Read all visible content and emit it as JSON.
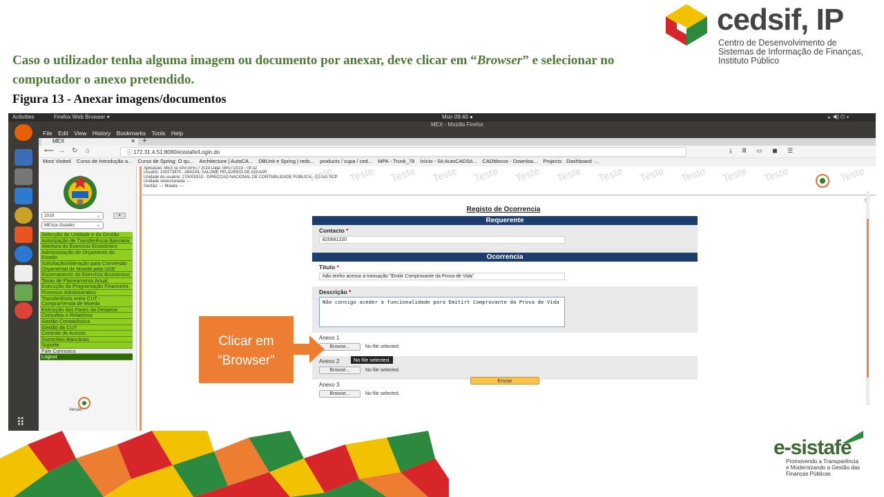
{
  "slide": {
    "intro_before": "Caso o utilizador tenha alguma imagem ou documento por anexar, deve clicar em “",
    "intro_emph": "Browser",
    "intro_after": "” e selecionar no computador o anexo pretendido.",
    "figure_caption": "Figura 13 - Anexar imagens/documentos"
  },
  "cedsif": {
    "name": "cedsif, IP",
    "subtitle_1": "Centro de Desenvolvimento de",
    "subtitle_2": "Sistemas de Informação de Finanças,",
    "subtitle_3": "Instituto Público"
  },
  "desktop": {
    "activities": "Activities",
    "app_menu": "Firefox Web Browser ▾",
    "clock": "Mon 09:40 ●",
    "window_title": "MEX - Mozilla Firefox"
  },
  "browser": {
    "menu": [
      "File",
      "Edit",
      "View",
      "History",
      "Bookmarks",
      "Tools",
      "Help"
    ],
    "tab_label": "MEX",
    "url": "172.31.4.51:8080/esistafe/Login.do",
    "bookmarks": [
      "Most Visited",
      "Curso de Introdução a...",
      "Curso de Spring: O qu...",
      "Architecture | AutoCA...",
      "DBUnit e Spring | reds...",
      "products / cupa / ced...",
      "MPA - Trunk_78",
      "Início - Só AutoCADSó...",
      "CADblocos - Downloa...",
      "Projects · Dashboard ·..."
    ]
  },
  "app": {
    "year": "2019",
    "module": "MEX(e-Sistafe)",
    "go_label": "»",
    "info_line_1": "Aplicação: MEX (e-SISTAFE) / 2019   Data: 08/07/2019 - 09:32",
    "info_line_2": "Usuário: 100273470 - ABIGAIL SALOMÉ FELIZARDO DE AGUIAR",
    "info_line_3": "Unidade do usuário: 27A000313 - DIRECCAO NACIONAL DE CONTABILIDADE PUBLICA - UG DO SCP",
    "info_line_4": "Unidade seleccionada: ---",
    "info_line_5": "Gestão: ---        Moeda: ---",
    "watermark": "Teste",
    "version_label": "Versão",
    "menu_items": [
      "Selecção de Unidade e da Gestão",
      "Autorização de Transferência Bancária",
      "Abertura do Exercício Económico",
      "Administração do Orçamento do Estado",
      "Solicitação/Alteração para Conversão Orçamental de Moeda pela UGE",
      "Encerramento do Exercício Económico",
      "Taxas de Planeamento Anual",
      "Execução da Programação Financeira",
      "Processo Administrativo",
      "Transferência entre CUT - Compra/Venda de Moeda",
      "Execução das Fases da Despesa",
      "Consultas e Relatórios",
      "Gestão Contabilística",
      "Gestão da CUT",
      "Controle de Acesso",
      "Domicílios Bancários",
      "Suporte",
      "Fale Connosco",
      "Logout"
    ]
  },
  "form": {
    "title": "Registo de Ocorrencia",
    "section_requerente": "Requerente",
    "contacto_label": "Contacto",
    "contacto_value": "820681220",
    "section_ocorrencia": "Ocorrencia",
    "titulo_label": "Título",
    "titulo_value": "Não tenho acesso a transação \"Emitir Comprovante da Prova de Vida\"",
    "descricao_label": "Descrição",
    "descricao_value": "Não consigo aceder a funcionalidade para Emitirt Comprovante da Prova de Vida",
    "required_mark": "*",
    "anexos": [
      {
        "label": "Anexo 1",
        "button": "Browse...",
        "status": "No file selected."
      },
      {
        "label": "Anexo 2",
        "button": "Browse...",
        "status": "No file selected."
      },
      {
        "label": "Anexo 3",
        "button": "Browse...",
        "status": "No file selected."
      }
    ],
    "tooltip": "No file selected.",
    "submit": "Enviar"
  },
  "callout": {
    "line_1": "Clicar em",
    "line_2": "“Browser”",
    "color": "#ed7d31"
  },
  "esistafe": {
    "word": "e-sistafe",
    "tagline_1": "Promovendo a Transparência",
    "tagline_2": "e Modernizando a Gestão das",
    "tagline_3": "Finanças Públicas"
  }
}
